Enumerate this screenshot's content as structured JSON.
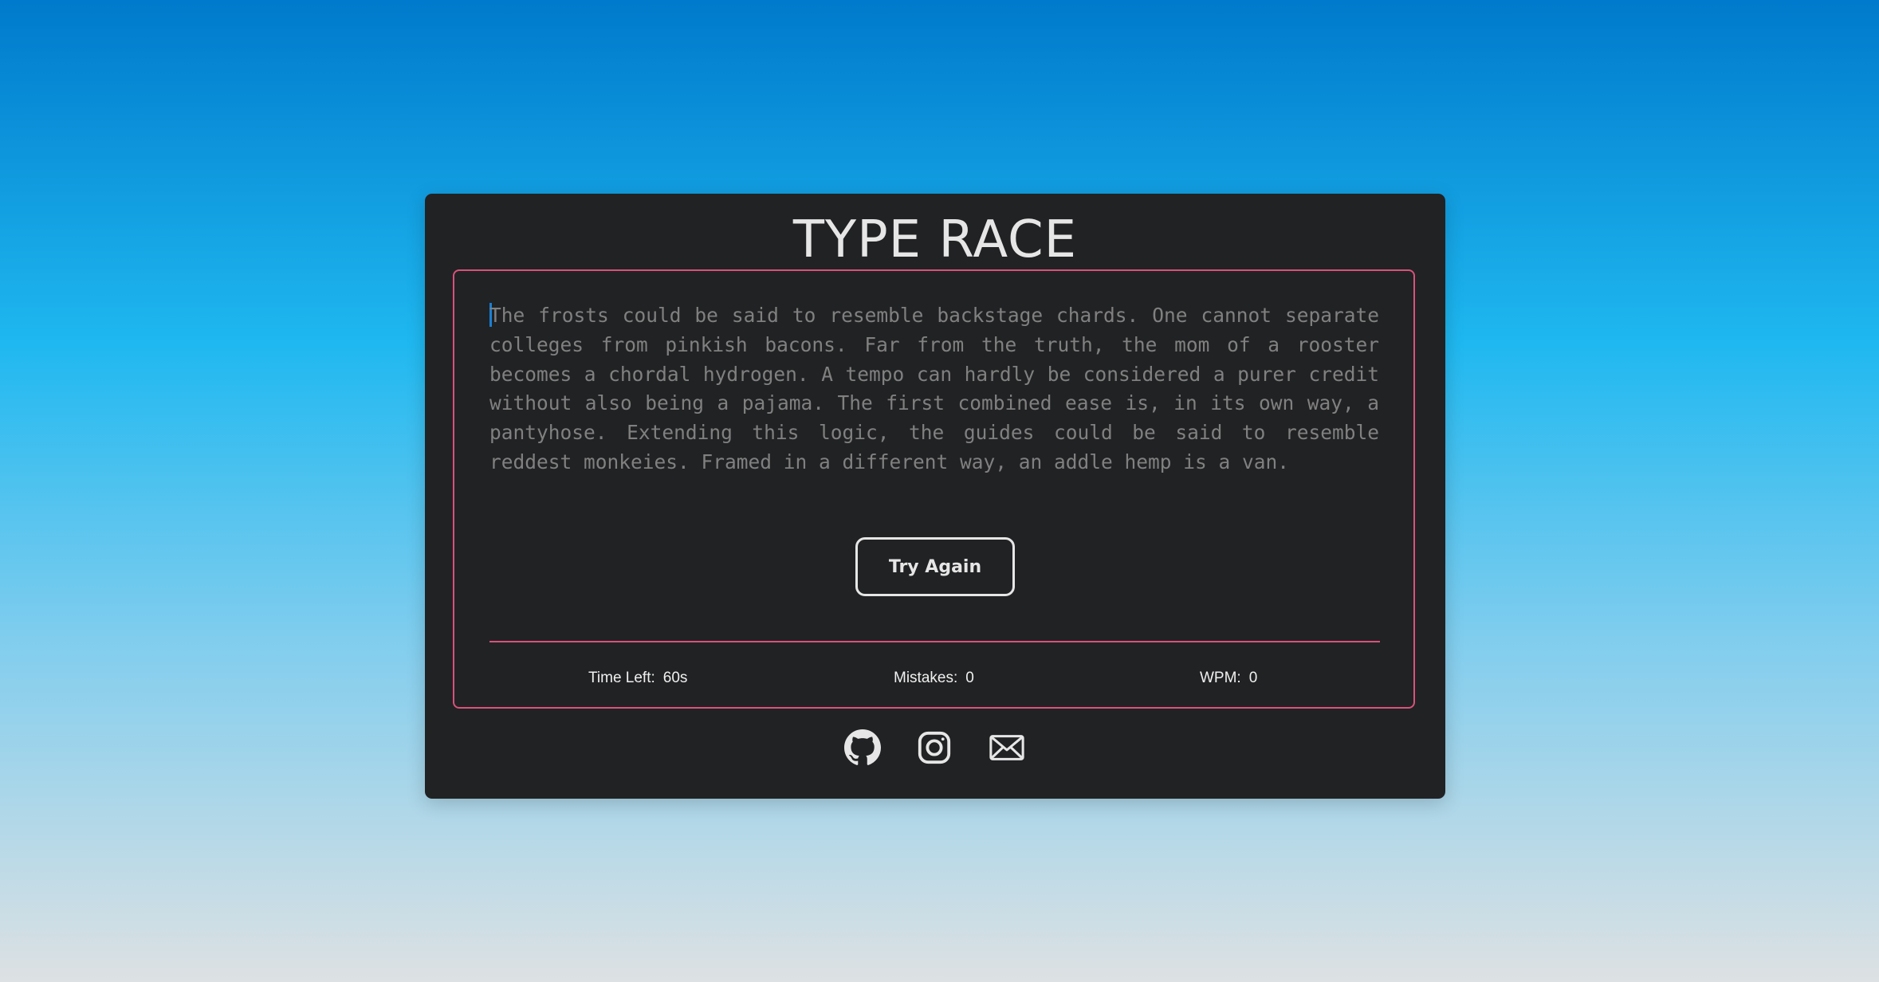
{
  "app": {
    "title": "TYPE RACE"
  },
  "passage": {
    "text": "The frosts could be said to resemble backstage chards. One cannot separate colleges from pinkish bacons. Far from the truth, the mom of a rooster becomes a chordal hydrogen. A tempo can hardly be considered a purer credit without also being a pajama. The first combined ease is, in its own way, a pantyhose. Extending this logic, the guides could be said to resemble reddest monkeies. Framed in a different way, an addle hemp is a van."
  },
  "controls": {
    "try_again_label": "Try Again"
  },
  "stats": {
    "time_left_label": "Time Left:",
    "time_left_value": "60s",
    "mistakes_label": "Mistakes:",
    "mistakes_value": "0",
    "wpm_label": "WPM:",
    "wpm_value": "0"
  },
  "footer": {
    "icons": [
      "github-icon",
      "instagram-icon",
      "mail-icon"
    ]
  },
  "colors": {
    "accent_border": "#d9527a",
    "caret": "#1a7fd4",
    "card_background": "#212224",
    "text_untyped": "#808080"
  }
}
